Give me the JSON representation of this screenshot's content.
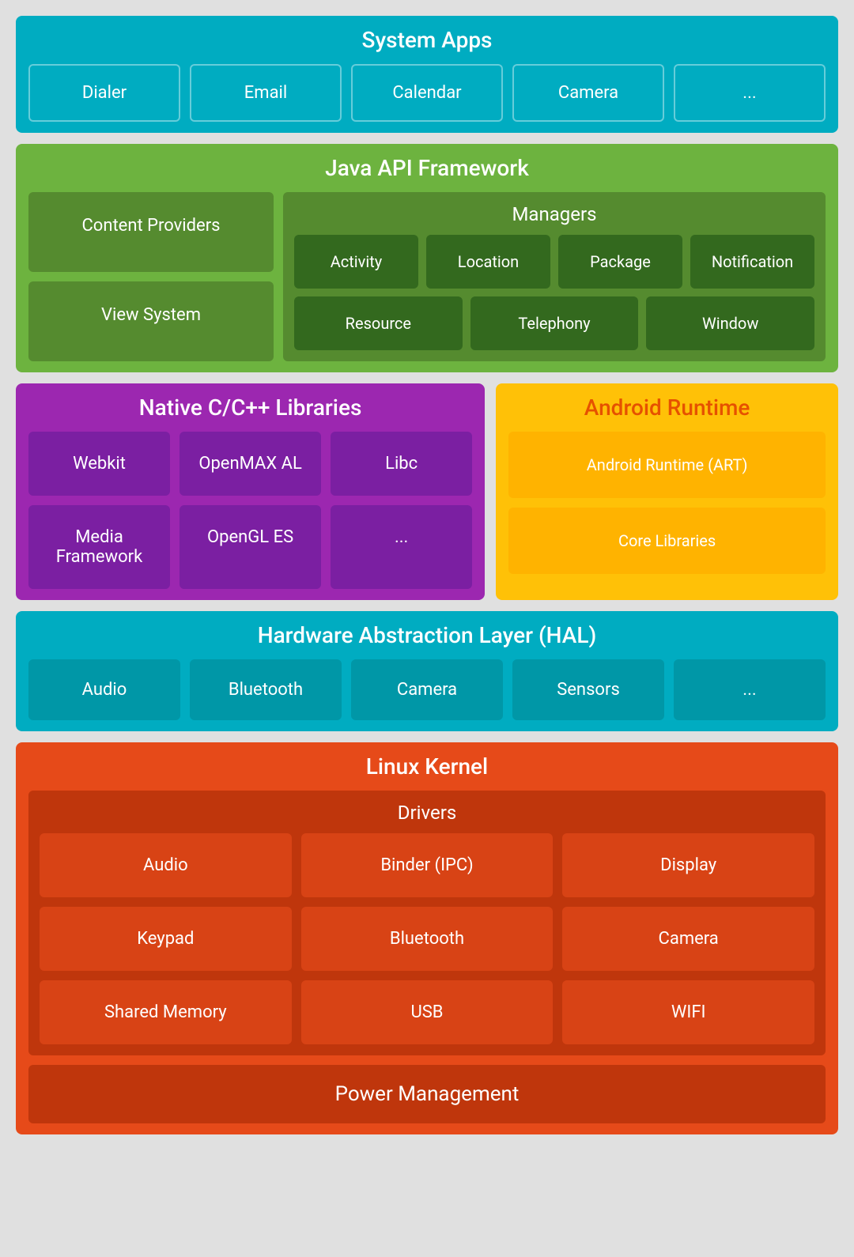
{
  "systemApps": {
    "title": "System Apps",
    "items": [
      "Dialer",
      "Email",
      "Calendar",
      "Camera",
      "..."
    ]
  },
  "javaApi": {
    "title": "Java API Framework",
    "contentProviders": "Content Providers",
    "viewSystem": "View System",
    "managers": {
      "title": "Managers",
      "row1": [
        "Activity",
        "Location",
        "Package",
        "Notification"
      ],
      "row2": [
        "Resource",
        "Telephony",
        "Window"
      ]
    }
  },
  "nativeCpp": {
    "title": "Native C/C++ Libraries",
    "items": [
      "Webkit",
      "OpenMAX AL",
      "Libc",
      "Media Framework",
      "OpenGL ES",
      "..."
    ]
  },
  "androidRuntime": {
    "title": "Android Runtime",
    "items": [
      "Android Runtime (ART)",
      "Core Libraries"
    ]
  },
  "hal": {
    "title": "Hardware Abstraction Layer (HAL)",
    "items": [
      "Audio",
      "Bluetooth",
      "Camera",
      "Sensors",
      "..."
    ]
  },
  "linuxKernel": {
    "title": "Linux Kernel",
    "drivers": {
      "title": "Drivers",
      "items": [
        "Audio",
        "Binder (IPC)",
        "Display",
        "Keypad",
        "Bluetooth",
        "Camera",
        "Shared Memory",
        "USB",
        "WIFI"
      ]
    },
    "powerManagement": "Power Management"
  }
}
